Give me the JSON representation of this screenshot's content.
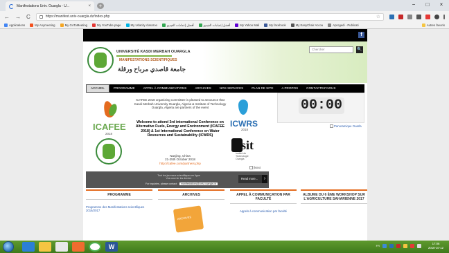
{
  "browser": {
    "tab_title": "Manifestations Univ. Ouargla - U...",
    "tab_close": "×",
    "new_tab": "+",
    "win_min": "−",
    "win_max": "□",
    "win_close": "×",
    "back": "←",
    "forward": "→",
    "reload": "C",
    "url": "https://manifest.univ-ouargla.dz/index.php",
    "bookmarks": [
      {
        "label": "Applications",
        "color": "#4285f4"
      },
      {
        "label": "My Anymeeting",
        "color": "#f4511e"
      },
      {
        "label": "My GoToMeeting",
        "color": "#f5a623"
      },
      {
        "label": "My YouTube page",
        "color": "#e53935"
      },
      {
        "label": "My Udacity classroo",
        "color": "#01b3e3"
      },
      {
        "label": "أفضل إعدادات الفيديو",
        "color": "#34a853"
      },
      {
        "label": "أفضل إعدادات الفيديو",
        "color": "#34a853"
      },
      {
        "label": "My Yahoo Mail",
        "color": "#6001d2"
      },
      {
        "label": "My facebook",
        "color": "#3b5998"
      },
      {
        "label": "My EasyChair Accou",
        "color": "#555555"
      },
      {
        "label": "Aprogedi - Publicati",
        "color": "#888888"
      }
    ],
    "more_bookmarks": "Autres favoris"
  },
  "site": {
    "univ_en": "UNIVERSITÉ KASDI MERBAH OUARGLA",
    "manifestations": "MANIFESTATIONS SCIENTIFIQUES",
    "univ_ar": "جامعة قاصدي مرباح ورقلة",
    "search_placeholder": "Chercher",
    "search_button": "🔍",
    "facebook": "f",
    "menu": [
      "ACCUEIL",
      "PROGRAMME",
      "APPEL À COMMUNICATIONS",
      "ARCHIVES",
      "NOS SERVICES",
      "PLAN DE SITE",
      "A PROPOS",
      "CONTACTEZ NOUS"
    ]
  },
  "content": {
    "icafee": "ICAFEE",
    "icafee_year": "2018",
    "icwrs": "ICWRS",
    "icwrs_year": "2018",
    "announce": "ICAFEE 2018 organizing committee is pleased to announce that Kasdi Merbah University Ouargla, Algeria & Institute of Technology Ouargla, Algeria are partners of the event",
    "welcome": "Welcome to attend 3rd international Conference on Alternative Fuels, Energy and Environment (ICAFEE 2018) & 1st International Conference on Water Resources and Sustainability (ICWRS)",
    "venue_city": "Nanjing, China",
    "venue_date": "21-25th October 2018",
    "venue_link": "http://icafee.com/partners.php",
    "sit_letters": "sit",
    "sit_caption": "Institut de Technologie Ouargla",
    "countdown": "00:00",
    "pano_caption": "Panoramique Ouarla",
    "img_broken": "[ktext",
    "banner_line1": "Tout les journaux scientifiques en ligne",
    "banner_line2": "Vos courrier les dernier",
    "banner_contact": "For inquiries, please contact:",
    "banner_email": "manifestations@univ-ouargla.dz",
    "read_more": "Read more..."
  },
  "columns": [
    {
      "heading": "PROGRAMME",
      "link": "Programme des Manifestations scientifiques 2016/2017"
    },
    {
      "heading": "ARCHIVES",
      "link": "",
      "book": "ARCHIVES"
    },
    {
      "heading": "APPEL À COMMUNICATION PAR FACULTÉ",
      "link": "Appels à communication par faculté"
    },
    {
      "heading": "ALBUME DU 6 ÈME WORKSHOP SUR L'AGRICULTURE SAHARIENNE 2017",
      "link": ""
    }
  ],
  "taskbar": {
    "word_label": "W",
    "lang": "FR",
    "time": "17:06",
    "date": "2018-10-12"
  }
}
